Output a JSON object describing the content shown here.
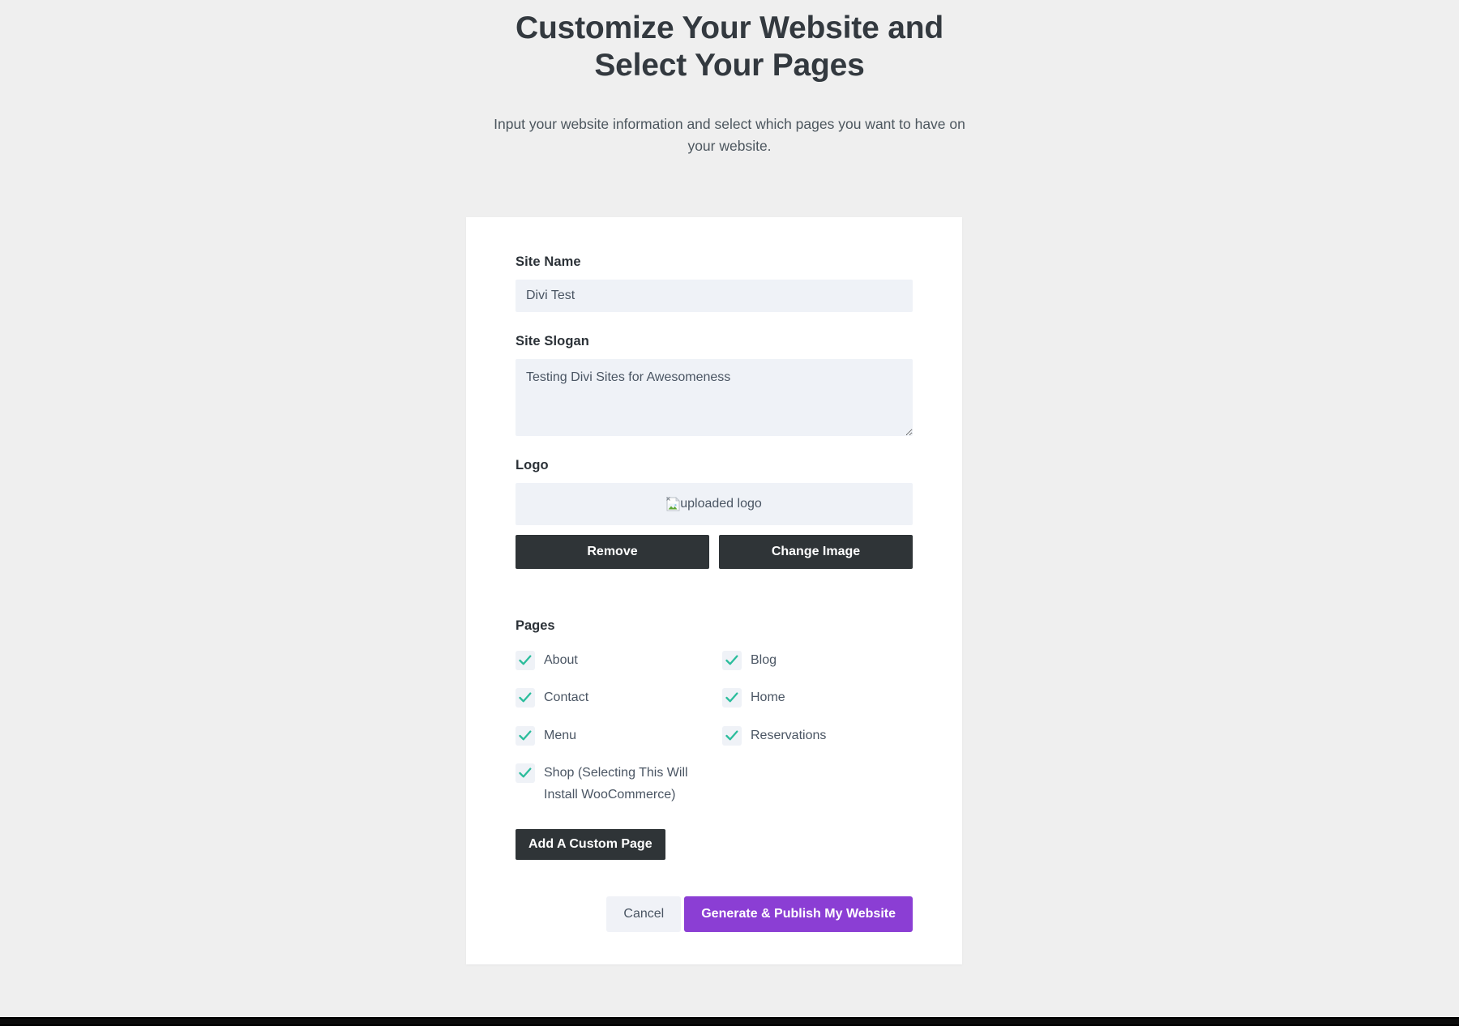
{
  "header": {
    "title": "Customize Your Website and Select Your Pages",
    "subtitle": "Input your website information and select which pages you want to have on your website."
  },
  "form": {
    "site_name": {
      "label": "Site Name",
      "value": "Divi Test",
      "placeholder": "Site Name"
    },
    "site_slogan": {
      "label": "Site Slogan",
      "value": "Testing Divi Sites for Awesomeness",
      "placeholder": "Site Slogan"
    },
    "logo": {
      "label": "Logo",
      "preview_alt": "uploaded logo",
      "remove_label": "Remove",
      "change_label": "Change Image"
    }
  },
  "pages": {
    "label": "Pages",
    "items": [
      {
        "label": "About",
        "checked": true
      },
      {
        "label": "Blog",
        "checked": true
      },
      {
        "label": "Contact",
        "checked": true
      },
      {
        "label": "Home",
        "checked": true
      },
      {
        "label": "Menu",
        "checked": true
      },
      {
        "label": "Reservations",
        "checked": true
      },
      {
        "label": "Shop (Selecting This Will Install WooCommerce)",
        "checked": true
      }
    ],
    "add_custom_page_label": "Add A Custom Page"
  },
  "actions": {
    "cancel_label": "Cancel",
    "submit_label": "Generate & Publish My Website"
  },
  "colors": {
    "page_background": "#efefef",
    "card_background": "#ffffff",
    "input_background": "#eff2f7",
    "dark_button": "#2f3437",
    "primary_button": "#8b3ed4",
    "cancel_button": "#f0f2f7",
    "checkmark": "#2bbd9c",
    "heading_text": "#33393f",
    "body_text": "#4a5563"
  }
}
